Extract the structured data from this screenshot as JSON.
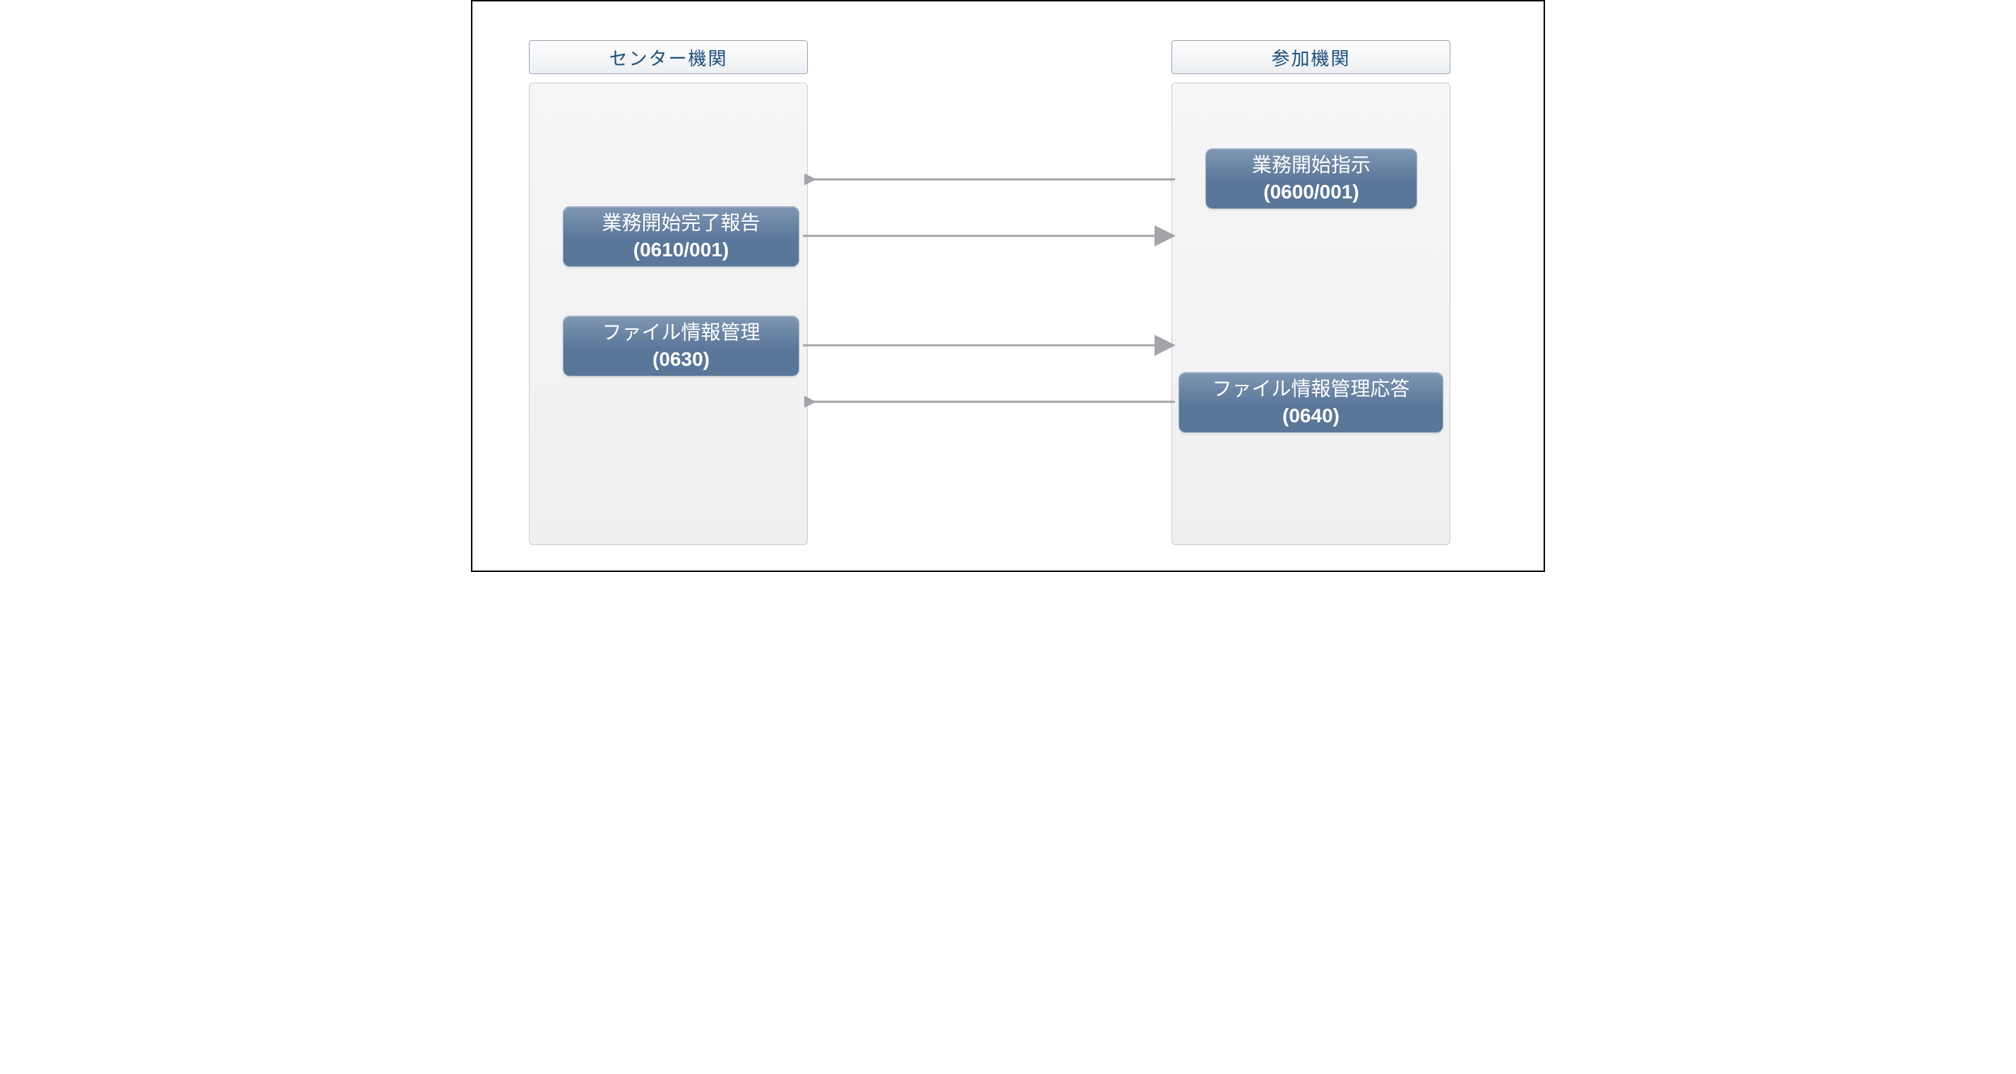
{
  "lanes": {
    "left": {
      "header": "センター機関"
    },
    "right": {
      "header": "参加機関"
    }
  },
  "nodes": {
    "n1": {
      "title": "業務開始指示",
      "code": "(0600/001)"
    },
    "n2": {
      "title": "業務開始完了報告",
      "code": "(0610/001)"
    },
    "n3": {
      "title": "ファイル情報管理",
      "code": "(0630)"
    },
    "n4": {
      "title": "ファイル情報管理応答",
      "code": "(0640)"
    }
  },
  "colors": {
    "lane_header_text": "#1f4e79",
    "node_bg_top": "#7f97b3",
    "node_bg_bottom": "#5a7699",
    "arrow": "#a3a5a8"
  },
  "diagram": {
    "description": "Sequence/message-flow diagram between two lanes (センター機関 on left, 参加機関 on right). Arrows: 0600/001 right→left, 0610/001 left→right, 0630 left→right, 0640 right→left.",
    "messages": [
      {
        "from": "right",
        "to": "left",
        "node": "n1"
      },
      {
        "from": "left",
        "to": "right",
        "node": "n2"
      },
      {
        "from": "left",
        "to": "right",
        "node": "n3"
      },
      {
        "from": "right",
        "to": "left",
        "node": "n4"
      }
    ]
  }
}
